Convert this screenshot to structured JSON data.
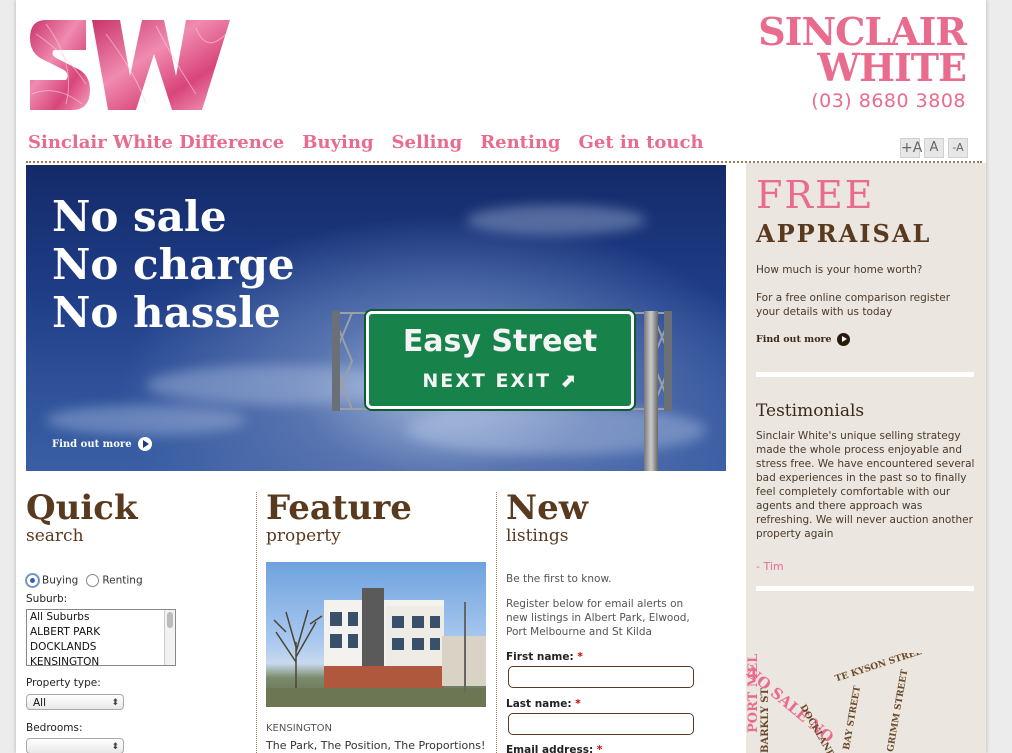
{
  "brand": {
    "logo_text": "SW",
    "name_line1": "SINCLAIR",
    "name_line2": "WHITE",
    "phone": "(03) 8680 3808"
  },
  "nav": {
    "items": [
      {
        "label": "Sinclair White Difference"
      },
      {
        "label": "Buying"
      },
      {
        "label": "Selling"
      },
      {
        "label": "Renting"
      },
      {
        "label": "Get in touch"
      }
    ]
  },
  "font_controls": {
    "increase": "+A",
    "normal": "A",
    "decrease": "-A"
  },
  "hero": {
    "headline_1": "No sale",
    "headline_2": "No charge",
    "headline_3": "No hassle",
    "sign_line1": "Easy Street",
    "sign_line2": "NEXT EXIT ⬈",
    "find_out_more": "Find out more"
  },
  "sidebar": {
    "free": "FREE",
    "appraisal": "APPRAISAL",
    "question": "How much is your home worth?",
    "pitch": "For a free online comparison register your details with us today",
    "find_out_more": "Find out more",
    "testimonials_title": "Testimonials",
    "testimonial": "Sinclair White's unique selling strategy made the whole process enjoyable and stress free. We have encountered several bad experiences in the past so to finally feel completely comfortable with our agents and there approach was refreshing. We will never auction another property again",
    "author": "- Tim",
    "stamp_words": [
      "NO SALE NO",
      "PORT MELB",
      "BARKLY ST",
      "TE KYSON STREET",
      "BAY STREET",
      "GRIMM STREET",
      "DOCKLANDS"
    ]
  },
  "quick_search": {
    "title": "Quick",
    "subtitle": "search",
    "radio_buying": "Buying",
    "radio_renting": "Renting",
    "suburb_label": "Suburb:",
    "suburbs": [
      "All Suburbs",
      "ALBERT PARK",
      "DOCKLANDS",
      "KENSINGTON"
    ],
    "type_label": "Property type:",
    "type_value": "All",
    "bedrooms_label": "Bedrooms:",
    "bedrooms_value": ""
  },
  "feature": {
    "title": "Feature",
    "subtitle": "property",
    "suburb": "KENSINGTON",
    "caption": "The Park, The Position, The Proportions!"
  },
  "new_listings": {
    "title": "New",
    "subtitle": "listings",
    "intro": "Be the first to know.",
    "body": "Register below for email alerts on new listings in Albert Park, Elwood, Port Melbourne and St Kilda",
    "first_name_label": "First name:",
    "last_name_label": "Last name:",
    "email_label": "Email address:",
    "required_mark": "*"
  },
  "colors": {
    "accent_pink": "#e96b8d",
    "brown": "#5a3a1e",
    "sidebar_bg": "#ebe6df"
  }
}
